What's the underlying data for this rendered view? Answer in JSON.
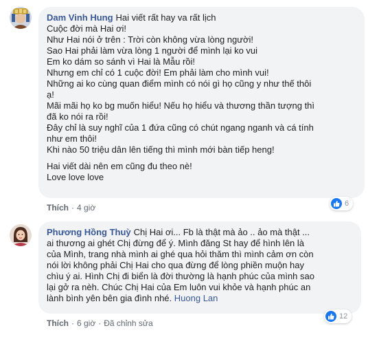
{
  "comments": [
    {
      "author": "Dam Vinh Hung",
      "first_line": "Hai viết rất hay va rất lịch",
      "paragraphs": [
        [
          "Cuộc đời mà Hai ơi!",
          "Như Hai nói ở trên : Trời còn không vừa lòng người!",
          "Sao Hai phải làm vừa lòng 1 người để mình lại ko vui",
          "Em ko dám so sánh vì Hai là Mẫu rồi!",
          "Nhưng em chỉ có 1 cuộc đời! Em phải làm cho mình vui!",
          "Những ai ko cùng quan điểm mình có nói gì họ cũng y như thế thôi",
          "ạ!",
          "Mãi mãi họ ko bg muốn hiểu! Nếu họ hiểu và thương thần tượng thì",
          "đã ko nói ra rồi!",
          "Đây chỉ là suy nghĩ của 1 đứa cũng có chút ngang nganh và cá tính",
          "như em thôi!",
          "Khi nào 50 triệu dân lên tiếng thì mình mới bàn tiếp heng!"
        ],
        [
          "Hai viết dài nên em cũng đu theo nè!",
          "Love love love"
        ]
      ],
      "like_label": "Thích",
      "time": "4 giờ",
      "reaction_count": "6"
    },
    {
      "author": "Phương Hồng Thuỳ",
      "first_line": "Chị Hai ơi... Fb là thật mà ảo .. ảo mà thật ...",
      "lines": [
        "ai thương ai ghét Chị đừng để ý. Mình đăng St hay để hình lên là",
        "của Mình, trang nhà mình ai ghé qua hỏi thăm thì mình cảm ơn còn",
        "nói lời không phải Chị Hai cho qua đừng để lòng phiền muộn hay",
        "chìu ý ai. Hình Chị đi biển là đời thường là hạnh phúc của mình sao",
        "lại gở ra nèh. Chúc Chị Hai của Em luôn vui khỏe và hạnh phúc an"
      ],
      "last_line_text": "lành bình yên bên gia đình nhé.",
      "tag": "Huong Lan",
      "like_label": "Thích",
      "time": "6 giờ",
      "edited_label": "Đã chỉnh sửa",
      "reaction_count": "12"
    }
  ],
  "colors": {
    "bubble": "#f2f3f5",
    "author": "#385898",
    "like_blue": "#1877f2",
    "meta": "#606770"
  },
  "icons": [
    "avatar-dam-vinh-hung",
    "avatar-phuong-hong-thuy",
    "thumbs-up-icon"
  ]
}
